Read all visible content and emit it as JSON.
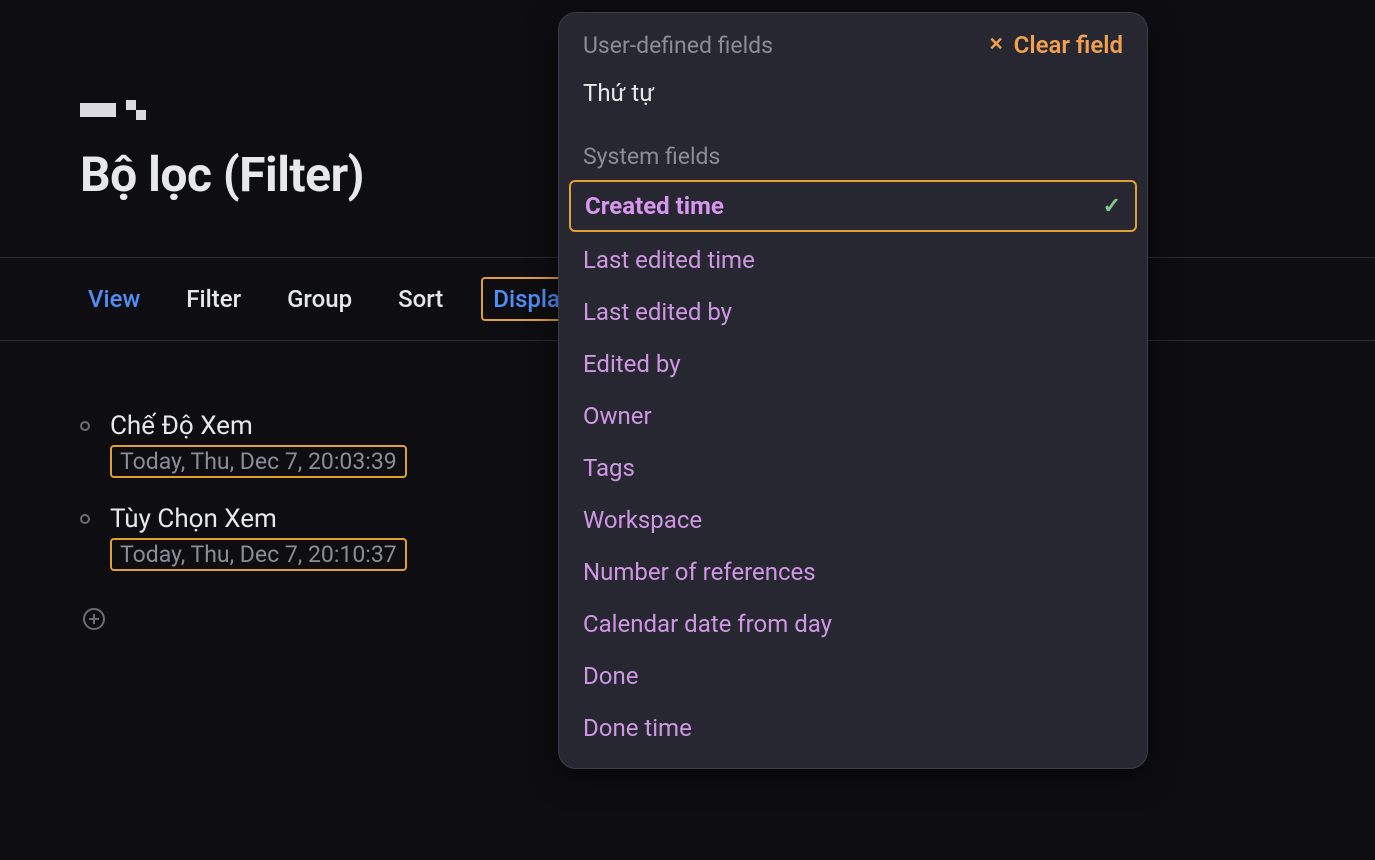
{
  "title": "Bộ lọc (Filter)",
  "tabs": {
    "view": "View",
    "filter": "Filter",
    "group": "Group",
    "sort": "Sort",
    "display": "Display"
  },
  "list": {
    "items": [
      {
        "title": "Chế Độ Xem",
        "date": "Today, Thu, Dec 7, 20:03:39"
      },
      {
        "title": "Tùy Chọn Xem",
        "date": "Today, Thu, Dec 7, 20:10:37"
      }
    ]
  },
  "dropdown": {
    "user_fields_label": "User-defined fields",
    "clear_label": "Clear field",
    "user_fields": [
      "Thứ tự"
    ],
    "system_fields_label": "System fields",
    "system_fields": [
      {
        "label": "Created time",
        "selected": true
      },
      {
        "label": "Last edited time",
        "selected": false
      },
      {
        "label": "Last edited by",
        "selected": false
      },
      {
        "label": "Edited by",
        "selected": false
      },
      {
        "label": "Owner",
        "selected": false
      },
      {
        "label": "Tags",
        "selected": false
      },
      {
        "label": "Workspace",
        "selected": false
      },
      {
        "label": "Number of references",
        "selected": false
      },
      {
        "label": "Calendar date from day",
        "selected": false
      },
      {
        "label": "Done",
        "selected": false
      },
      {
        "label": "Done time",
        "selected": false
      }
    ]
  }
}
